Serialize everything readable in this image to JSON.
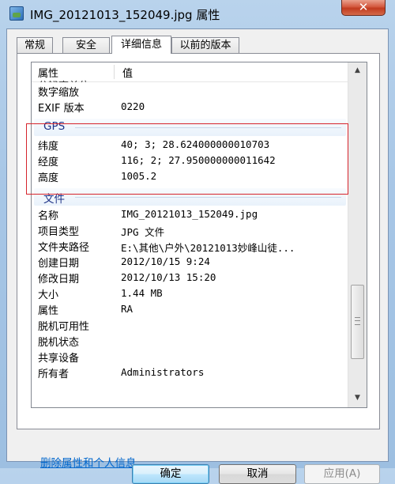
{
  "window": {
    "title": "IMG_20121013_152049.jpg 属性",
    "close_label": "✕"
  },
  "tabs": [
    {
      "label": "常规",
      "active": false
    },
    {
      "label": "安全",
      "active": false
    },
    {
      "label": "详细信息",
      "active": true
    },
    {
      "label": "以前的版本",
      "active": false
    }
  ],
  "list": {
    "header_property": "属性",
    "header_value": "值",
    "cut_row": "分辨率单位",
    "rows_top": [
      {
        "k": "数字缩放",
        "v": ""
      },
      {
        "k": "EXIF 版本",
        "v": "0220"
      }
    ],
    "gps_group": "GPS",
    "gps_rows": [
      {
        "k": "纬度",
        "v": "40; 3; 28.624000000010703"
      },
      {
        "k": "经度",
        "v": "116; 2; 27.950000000011642"
      },
      {
        "k": "高度",
        "v": "1005.2"
      }
    ],
    "file_group": "文件",
    "file_rows": [
      {
        "k": "名称",
        "v": "IMG_20121013_152049.jpg"
      },
      {
        "k": "项目类型",
        "v": "JPG 文件"
      },
      {
        "k": "文件夹路径",
        "v": "E:\\其他\\户外\\20121013妙峰山徒..."
      },
      {
        "k": "创建日期",
        "v": "2012/10/15 9:24"
      },
      {
        "k": "修改日期",
        "v": "2012/10/13 15:20"
      },
      {
        "k": "大小",
        "v": "1.44 MB"
      },
      {
        "k": "属性",
        "v": "RA"
      },
      {
        "k": "脱机可用性",
        "v": ""
      },
      {
        "k": "脱机状态",
        "v": ""
      },
      {
        "k": "共享设备",
        "v": ""
      },
      {
        "k": "所有者",
        "v": "Administrators"
      }
    ]
  },
  "remove_link": "删除属性和个人信息",
  "buttons": {
    "ok": "确定",
    "cancel": "取消",
    "apply": "应用(A)"
  },
  "colors": {
    "highlight_border": "#d6242c",
    "group_text": "#1e3287",
    "link": "#0066cc"
  }
}
